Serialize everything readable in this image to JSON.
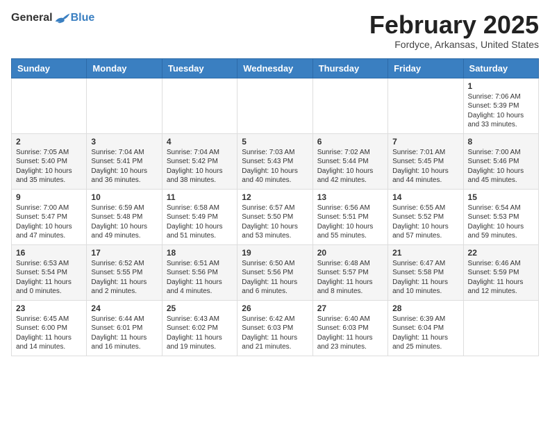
{
  "header": {
    "logo_general": "General",
    "logo_blue": "Blue",
    "month_title": "February 2025",
    "location": "Fordyce, Arkansas, United States"
  },
  "weekdays": [
    "Sunday",
    "Monday",
    "Tuesday",
    "Wednesday",
    "Thursday",
    "Friday",
    "Saturday"
  ],
  "weeks": [
    [
      {
        "day": "",
        "info": ""
      },
      {
        "day": "",
        "info": ""
      },
      {
        "day": "",
        "info": ""
      },
      {
        "day": "",
        "info": ""
      },
      {
        "day": "",
        "info": ""
      },
      {
        "day": "",
        "info": ""
      },
      {
        "day": "1",
        "info": "Sunrise: 7:06 AM\nSunset: 5:39 PM\nDaylight: 10 hours and 33 minutes."
      }
    ],
    [
      {
        "day": "2",
        "info": "Sunrise: 7:05 AM\nSunset: 5:40 PM\nDaylight: 10 hours and 35 minutes."
      },
      {
        "day": "3",
        "info": "Sunrise: 7:04 AM\nSunset: 5:41 PM\nDaylight: 10 hours and 36 minutes."
      },
      {
        "day": "4",
        "info": "Sunrise: 7:04 AM\nSunset: 5:42 PM\nDaylight: 10 hours and 38 minutes."
      },
      {
        "day": "5",
        "info": "Sunrise: 7:03 AM\nSunset: 5:43 PM\nDaylight: 10 hours and 40 minutes."
      },
      {
        "day": "6",
        "info": "Sunrise: 7:02 AM\nSunset: 5:44 PM\nDaylight: 10 hours and 42 minutes."
      },
      {
        "day": "7",
        "info": "Sunrise: 7:01 AM\nSunset: 5:45 PM\nDaylight: 10 hours and 44 minutes."
      },
      {
        "day": "8",
        "info": "Sunrise: 7:00 AM\nSunset: 5:46 PM\nDaylight: 10 hours and 45 minutes."
      }
    ],
    [
      {
        "day": "9",
        "info": "Sunrise: 7:00 AM\nSunset: 5:47 PM\nDaylight: 10 hours and 47 minutes."
      },
      {
        "day": "10",
        "info": "Sunrise: 6:59 AM\nSunset: 5:48 PM\nDaylight: 10 hours and 49 minutes."
      },
      {
        "day": "11",
        "info": "Sunrise: 6:58 AM\nSunset: 5:49 PM\nDaylight: 10 hours and 51 minutes."
      },
      {
        "day": "12",
        "info": "Sunrise: 6:57 AM\nSunset: 5:50 PM\nDaylight: 10 hours and 53 minutes."
      },
      {
        "day": "13",
        "info": "Sunrise: 6:56 AM\nSunset: 5:51 PM\nDaylight: 10 hours and 55 minutes."
      },
      {
        "day": "14",
        "info": "Sunrise: 6:55 AM\nSunset: 5:52 PM\nDaylight: 10 hours and 57 minutes."
      },
      {
        "day": "15",
        "info": "Sunrise: 6:54 AM\nSunset: 5:53 PM\nDaylight: 10 hours and 59 minutes."
      }
    ],
    [
      {
        "day": "16",
        "info": "Sunrise: 6:53 AM\nSunset: 5:54 PM\nDaylight: 11 hours and 0 minutes."
      },
      {
        "day": "17",
        "info": "Sunrise: 6:52 AM\nSunset: 5:55 PM\nDaylight: 11 hours and 2 minutes."
      },
      {
        "day": "18",
        "info": "Sunrise: 6:51 AM\nSunset: 5:56 PM\nDaylight: 11 hours and 4 minutes."
      },
      {
        "day": "19",
        "info": "Sunrise: 6:50 AM\nSunset: 5:56 PM\nDaylight: 11 hours and 6 minutes."
      },
      {
        "day": "20",
        "info": "Sunrise: 6:48 AM\nSunset: 5:57 PM\nDaylight: 11 hours and 8 minutes."
      },
      {
        "day": "21",
        "info": "Sunrise: 6:47 AM\nSunset: 5:58 PM\nDaylight: 11 hours and 10 minutes."
      },
      {
        "day": "22",
        "info": "Sunrise: 6:46 AM\nSunset: 5:59 PM\nDaylight: 11 hours and 12 minutes."
      }
    ],
    [
      {
        "day": "23",
        "info": "Sunrise: 6:45 AM\nSunset: 6:00 PM\nDaylight: 11 hours and 14 minutes."
      },
      {
        "day": "24",
        "info": "Sunrise: 6:44 AM\nSunset: 6:01 PM\nDaylight: 11 hours and 16 minutes."
      },
      {
        "day": "25",
        "info": "Sunrise: 6:43 AM\nSunset: 6:02 PM\nDaylight: 11 hours and 19 minutes."
      },
      {
        "day": "26",
        "info": "Sunrise: 6:42 AM\nSunset: 6:03 PM\nDaylight: 11 hours and 21 minutes."
      },
      {
        "day": "27",
        "info": "Sunrise: 6:40 AM\nSunset: 6:03 PM\nDaylight: 11 hours and 23 minutes."
      },
      {
        "day": "28",
        "info": "Sunrise: 6:39 AM\nSunset: 6:04 PM\nDaylight: 11 hours and 25 minutes."
      },
      {
        "day": "",
        "info": ""
      }
    ]
  ]
}
